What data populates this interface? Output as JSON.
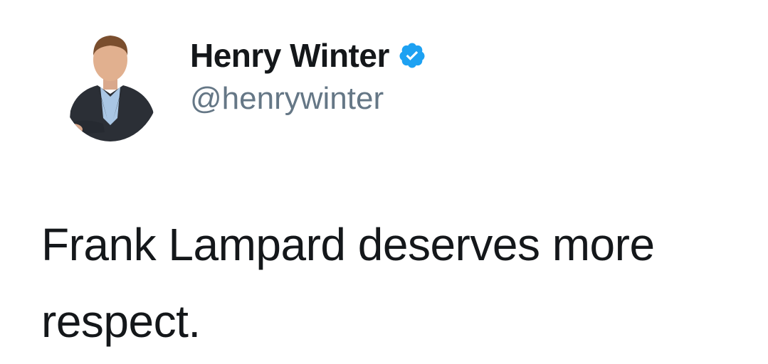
{
  "tweet": {
    "author": {
      "display_name": "Henry Winter",
      "handle": "@henrywinter",
      "verified": true,
      "avatar_icon": "profile-photo",
      "verified_icon": "verified-badge-icon"
    },
    "text": "Frank Lampard deserves more respect."
  },
  "colors": {
    "name": "#14171a",
    "handle": "#657786",
    "verified_badge": "#1da1f2",
    "background": "#ffffff"
  }
}
